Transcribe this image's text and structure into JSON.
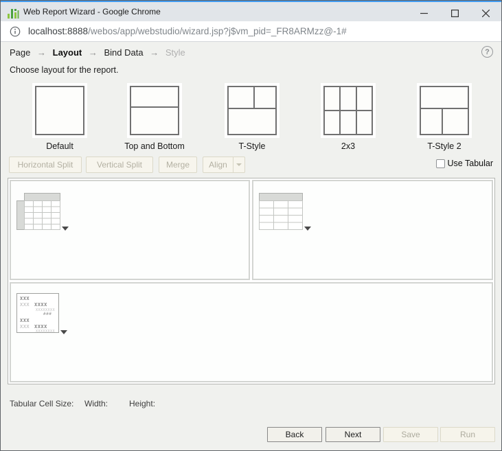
{
  "window": {
    "title": "Web Report Wizard - Google Chrome"
  },
  "address_bar": {
    "url_domain": "localhost:8888",
    "url_path": "/webos/app/webstudio/wizard.jsp?j$vm_pid=_FR8ARMzz@-1#"
  },
  "wizard": {
    "arrow": "→",
    "help_glyph": "?",
    "steps": [
      {
        "label": "Page",
        "state": "normal"
      },
      {
        "label": "Layout",
        "state": "current"
      },
      {
        "label": "Bind Data",
        "state": "normal"
      },
      {
        "label": "Style",
        "state": "disabled"
      }
    ],
    "instruction": "Choose layout for the report."
  },
  "layouts": [
    {
      "name": "Default"
    },
    {
      "name": "Top and Bottom"
    },
    {
      "name": "T-Style"
    },
    {
      "name": "2x3"
    },
    {
      "name": "T-Style 2"
    }
  ],
  "toolbar": {
    "horizontal_split": "Horizontal Split",
    "vertical_split": "Vertical Split",
    "merge": "Merge",
    "align": "Align",
    "use_tabular_label": "Use Tabular",
    "use_tabular_checked": false
  },
  "canvas": {
    "cells": [
      {
        "position": "top-left",
        "component_icon": "crosstab-icon"
      },
      {
        "position": "top-right",
        "component_icon": "table-icon"
      },
      {
        "position": "bottom",
        "component_icon": "banded-report-icon"
      }
    ]
  },
  "banded_icon": {
    "l1": "XXX",
    "l2a": "XXX",
    "l2b": "XXXX",
    "l3": "XXXXXXXX",
    "l4": "###"
  },
  "footer": {
    "tabular_cell_size_label": "Tabular Cell Size:",
    "width_label": "Width:",
    "width_value": "",
    "height_label": "Height:",
    "height_value": ""
  },
  "actions": {
    "back": "Back",
    "next": "Next",
    "save": "Save",
    "run": "Run"
  },
  "colors": {
    "accent_blue_top_border": "#419bf0",
    "logo_green_light": "#8cc63f",
    "logo_green_dark": "#4ba23f",
    "page_background": "#f0f1ee",
    "cell_border": "#d3d5d2",
    "disabled_text": "#b3b0a2"
  }
}
